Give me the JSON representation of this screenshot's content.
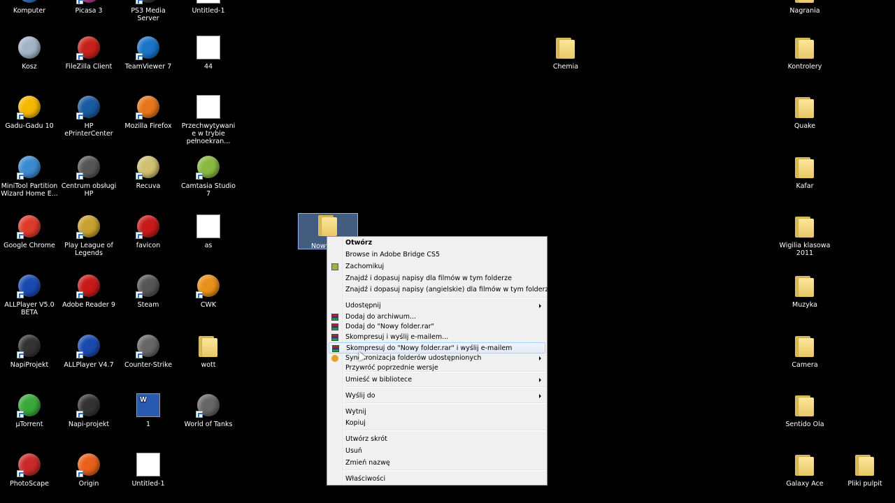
{
  "desktop": {
    "icons": [
      {
        "label": "Komputer",
        "icon": "computer-icon",
        "color": "#3a78c8"
      },
      {
        "label": "Picasa 3",
        "icon": "picasa-icon",
        "color": "#c04090"
      },
      {
        "label": "PS3 Media Server",
        "icon": "ps3-media-server-icon",
        "color": "#333333"
      },
      {
        "label": "Untitled-1",
        "icon": "document-icon",
        "color": "#ffffff"
      },
      {
        "label": "Nagrania",
        "icon": "folder-icon",
        "color": "#f5d76e"
      },
      {
        "label": "Kosz",
        "icon": "recycle-bin-icon",
        "color": "#a0b4c8"
      },
      {
        "label": "FileZilla Client",
        "icon": "filezilla-icon",
        "color": "#c8201a"
      },
      {
        "label": "TeamViewer 7",
        "icon": "teamviewer-icon",
        "color": "#1a74c8"
      },
      {
        "label": "44",
        "icon": "blank-file-icon",
        "color": "#ffffff"
      },
      {
        "label": "Chemia",
        "icon": "folder-icon",
        "color": "#f5d76e"
      },
      {
        "label": "Kontrolery",
        "icon": "folder-icon",
        "color": "#f5d76e"
      },
      {
        "label": "Gadu-Gadu 10",
        "icon": "gadu-gadu-icon",
        "color": "#f5b800"
      },
      {
        "label": "HP ePrinterCenter",
        "icon": "hp-eprinter-icon",
        "color": "#1a5aa0"
      },
      {
        "label": "Mozilla Firefox",
        "icon": "firefox-icon",
        "color": "#e8751a"
      },
      {
        "label": "Przechwytywanie w trybie pełnoekran...",
        "icon": "document-icon",
        "color": "#ffffff"
      },
      {
        "label": "Quake",
        "icon": "folder-icon",
        "color": "#f5d76e"
      },
      {
        "label": "MiniTool Partition Wizard Home E...",
        "icon": "minitool-icon",
        "color": "#3a8ad0"
      },
      {
        "label": "Centrum obsługi HP",
        "icon": "hp-icon",
        "color": "#555555"
      },
      {
        "label": "Recuva",
        "icon": "recuva-icon",
        "color": "#d0c070"
      },
      {
        "label": "Camtasia Studio 7",
        "icon": "camtasia-icon",
        "color": "#8ab840"
      },
      {
        "label": "Kafar",
        "icon": "folder-icon",
        "color": "#f5d76e"
      },
      {
        "label": "Google Chrome",
        "icon": "chrome-icon",
        "color": "#dd3a2a"
      },
      {
        "label": "Play League of Legends",
        "icon": "league-of-legends-icon",
        "color": "#c8a030"
      },
      {
        "label": "favicon",
        "icon": "favicon-icon",
        "color": "#c81a1a"
      },
      {
        "label": "as",
        "icon": "image-file-icon",
        "color": "#ffffff"
      },
      {
        "label": "Wigilia klasowa 2011",
        "icon": "folder-icon",
        "color": "#f5d76e"
      },
      {
        "label": "ALLPlayer V5.0 BETA",
        "icon": "allplayer-icon",
        "color": "#1a4ab0"
      },
      {
        "label": "Adobe Reader 9",
        "icon": "adobe-reader-icon",
        "color": "#c81a1a"
      },
      {
        "label": "Steam",
        "icon": "steam-icon",
        "color": "#555555"
      },
      {
        "label": "CWK",
        "icon": "cwk-icon",
        "color": "#e8901a"
      },
      {
        "label": "Muzyka",
        "icon": "folder-icon",
        "color": "#f5d76e"
      },
      {
        "label": "NapiProjekt",
        "icon": "napiprojekt-icon",
        "color": "#333333"
      },
      {
        "label": "ALLPlayer V4.7",
        "icon": "allplayer-icon",
        "color": "#1a4ab0"
      },
      {
        "label": "Counter-Strike",
        "icon": "counter-strike-icon",
        "color": "#666666"
      },
      {
        "label": "wott",
        "icon": "folder-icon",
        "color": "#f5d76e"
      },
      {
        "label": "Camera",
        "icon": "folder-icon",
        "color": "#f5d76e"
      },
      {
        "label": "µTorrent",
        "icon": "utorrent-icon",
        "color": "#3aa83a"
      },
      {
        "label": "Napi-projekt",
        "icon": "napiprojekt-icon",
        "color": "#333333"
      },
      {
        "label": "1",
        "icon": "word-document-icon",
        "color": "#2a5ab0"
      },
      {
        "label": "World of Tanks",
        "icon": "world-of-tanks-icon",
        "color": "#666666"
      },
      {
        "label": "Sentido Ola",
        "icon": "folder-icon",
        "color": "#f5d76e"
      },
      {
        "label": "PhotoScape",
        "icon": "photoscape-icon",
        "color": "#c82a2a"
      },
      {
        "label": "Origin",
        "icon": "origin-icon",
        "color": "#e8601a"
      },
      {
        "label": "Untitled-1",
        "icon": "image-file-icon",
        "color": "#ffffff"
      },
      {
        "label": "Galaxy Ace",
        "icon": "folder-icon",
        "color": "#f5d76e"
      },
      {
        "label": "Pliki pulpit",
        "icon": "folder-icon",
        "color": "#f5d76e"
      }
    ],
    "selected_folder_label": "Nowy"
  },
  "context_menu": {
    "items": [
      {
        "label": "Otwórz",
        "bold": true
      },
      {
        "label": "Browse in Adobe Bridge CS5"
      },
      {
        "label": "Zachomikuj",
        "icon": "chomikuj-icon"
      },
      {
        "label": "Znajdź i dopasuj napisy dla filmów w tym folderze"
      },
      {
        "label": "Znajdź i dopasuj napisy (angielskie) dla filmów w tym folderze"
      },
      {
        "label": "Udostępnij",
        "submenu": true
      },
      {
        "label": "Dodaj do archiwum...",
        "icon": "winrar-icon"
      },
      {
        "label": "Dodaj do \"Nowy folder.rar\"",
        "icon": "winrar-icon"
      },
      {
        "label": "Skompresuj i wyślij e-mailem...",
        "icon": "winrar-icon"
      },
      {
        "label": "Skompresuj do \"Nowy folder.rar\" i wyślij e-mailem",
        "icon": "winrar-icon",
        "hover": true
      },
      {
        "label": "Synchronizacja folderów udostępnionych",
        "icon": "sync-icon",
        "submenu": true
      },
      {
        "label": "Przywróć poprzednie wersje"
      },
      {
        "label": "Umieść w bibliotece",
        "submenu": true
      },
      {
        "label": "Wyślij do",
        "submenu": true
      },
      {
        "label": "Wytnij"
      },
      {
        "label": "Kopiuj"
      },
      {
        "label": "Utwórz skrót"
      },
      {
        "label": "Usuń"
      },
      {
        "label": "Zmień nazwę"
      },
      {
        "label": "Właściwości"
      }
    ]
  }
}
